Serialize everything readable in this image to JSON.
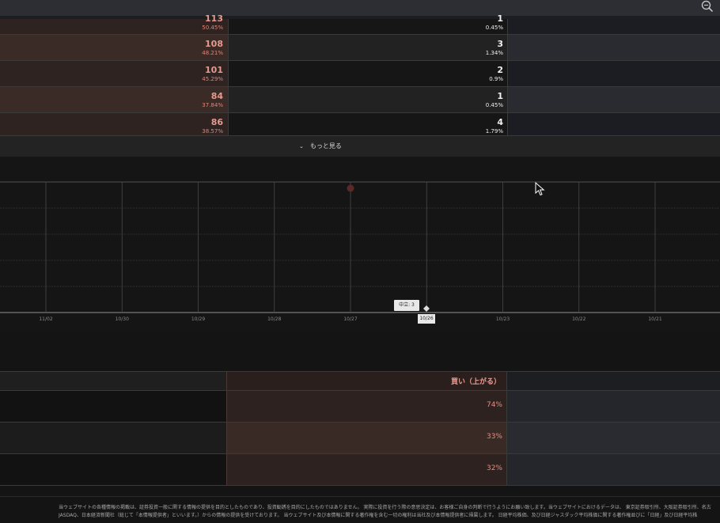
{
  "table_top": {
    "rows": [
      {
        "left_value": "113",
        "left_pct": "50.45%",
        "mid_value": "1",
        "mid_pct": "0.45%"
      },
      {
        "left_value": "108",
        "left_pct": "48.21%",
        "mid_value": "3",
        "mid_pct": "1.34%"
      },
      {
        "left_value": "101",
        "left_pct": "45.29%",
        "mid_value": "2",
        "mid_pct": "0.9%"
      },
      {
        "left_value": "84",
        "left_pct": "37.84%",
        "mid_value": "1",
        "mid_pct": "0.45%"
      },
      {
        "left_value": "86",
        "left_pct": "38.57%",
        "mid_value": "4",
        "mid_pct": "1.79%"
      }
    ]
  },
  "more_button": {
    "label": "もっと見る"
  },
  "chart": {
    "tooltip": "中立: 3",
    "highlight_date": "10/26",
    "dates": [
      "11/02",
      "10/30",
      "10/29",
      "10/28",
      "10/27",
      "10/26",
      "10/23",
      "10/22",
      "10/21"
    ]
  },
  "table_bottom": {
    "header_label": "買い（上がる）",
    "rows": [
      {
        "value": "74%"
      },
      {
        "value": "33%"
      },
      {
        "value": "32%"
      }
    ]
  },
  "footer": {
    "line1": "当ウェブサイトの各種情報の掲載は、証券投資一般に関する情報の提供を目的としたものであり、投資勧誘を目的にしたものではありません。 実際に投資を行う際の意思決定は、お客様ご自身の判断で行うようにお願い致します。当ウェブサイトにおけるデータは、 東京証券取引所、大阪証券取引所、名古",
    "line2": "JASDAQ、日本経済新聞社（総じて「本情報提供者」といいます。）からの情報の提供を受けております。 当ウェブサイト及び本情報に関する著作権を含む一切の権利は当社及び本情報提供者に帰属します。 日経平均株価、及び日経ジャスダック平均株価に関する著作権並びに「日経」及び日経平均株"
  },
  "colors": {
    "accent_red": "#e59a90",
    "background": "#141414"
  },
  "icons": {
    "zoom": "zoom-icon",
    "cursor": "mouse-cursor-icon",
    "chevron": "chevron-down-icon"
  }
}
